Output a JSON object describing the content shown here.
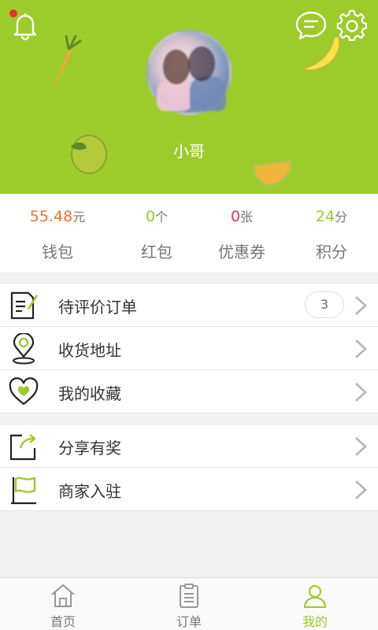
{
  "colors": {
    "brand": "#9dcb2c",
    "wallet": "#e8742a",
    "redpacket": "#9dcb2c",
    "coupon": "#e0336b",
    "points": "#9dcb2c",
    "notification_dot": "#e8322b"
  },
  "header": {
    "username": "小哥",
    "icons": [
      "bell-icon",
      "message-icon",
      "gear-icon"
    ]
  },
  "stats": [
    {
      "value": "55.48",
      "unit": "元",
      "label": "钱包"
    },
    {
      "value": "0",
      "unit": "个",
      "label": "红包"
    },
    {
      "value": "0",
      "unit": "张",
      "label": "优惠券"
    },
    {
      "value": "24",
      "unit": "分",
      "label": "积分"
    }
  ],
  "menu_group_1": [
    {
      "label": "待评价订单",
      "badge": "3",
      "icon": "review-order-icon"
    },
    {
      "label": "收货地址",
      "icon": "location-pin-icon"
    },
    {
      "label": "我的收藏",
      "icon": "heart-icon"
    }
  ],
  "menu_group_2": [
    {
      "label": "分享有奖",
      "icon": "share-icon"
    },
    {
      "label": "商家入驻",
      "icon": "flag-icon"
    }
  ],
  "tabbar": [
    {
      "label": "首页",
      "icon": "home-icon",
      "active": false
    },
    {
      "label": "订单",
      "icon": "clipboard-icon",
      "active": false
    },
    {
      "label": "我的",
      "icon": "user-icon",
      "active": true
    }
  ]
}
